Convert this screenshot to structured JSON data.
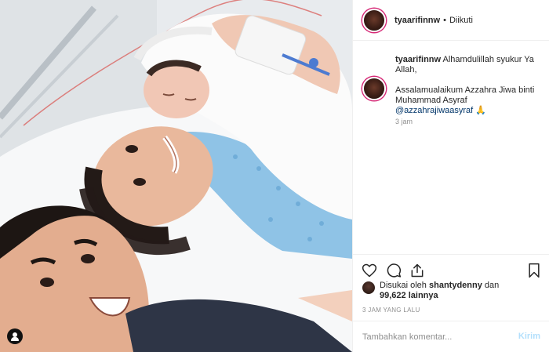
{
  "header": {
    "username": "tyaarifinnw",
    "separator": "•",
    "follow_status": "Diikuti",
    "avatar_icon": "profile-avatar"
  },
  "caption": {
    "username": "tyaarifinnw",
    "line1": "Alhamdulillah syukur Ya Allah,",
    "line2": "Assalamualaikum Azzahra Jiwa binti Muhammad Asyraf",
    "mention": "@azzahrajiwaasyraf",
    "emoji": "🙏",
    "time": "3 jam"
  },
  "actions": {
    "like_icon": "heart-icon",
    "comment_icon": "comment-icon",
    "share_icon": "share-icon",
    "save_icon": "bookmark-icon"
  },
  "likes": {
    "prefix": "Disukai oleh",
    "user": "shantydenny",
    "conj": "dan",
    "count": "99,622",
    "suffix": "lainnya"
  },
  "post_time": "3 JAM YANG LALU",
  "comment_box": {
    "placeholder": "Tambahkan komentar...",
    "post_label": "Kirim"
  },
  "colors": {
    "accent": "#b2dffc",
    "mention": "#003569",
    "muted": "#8e8e8e",
    "text": "#262626"
  }
}
